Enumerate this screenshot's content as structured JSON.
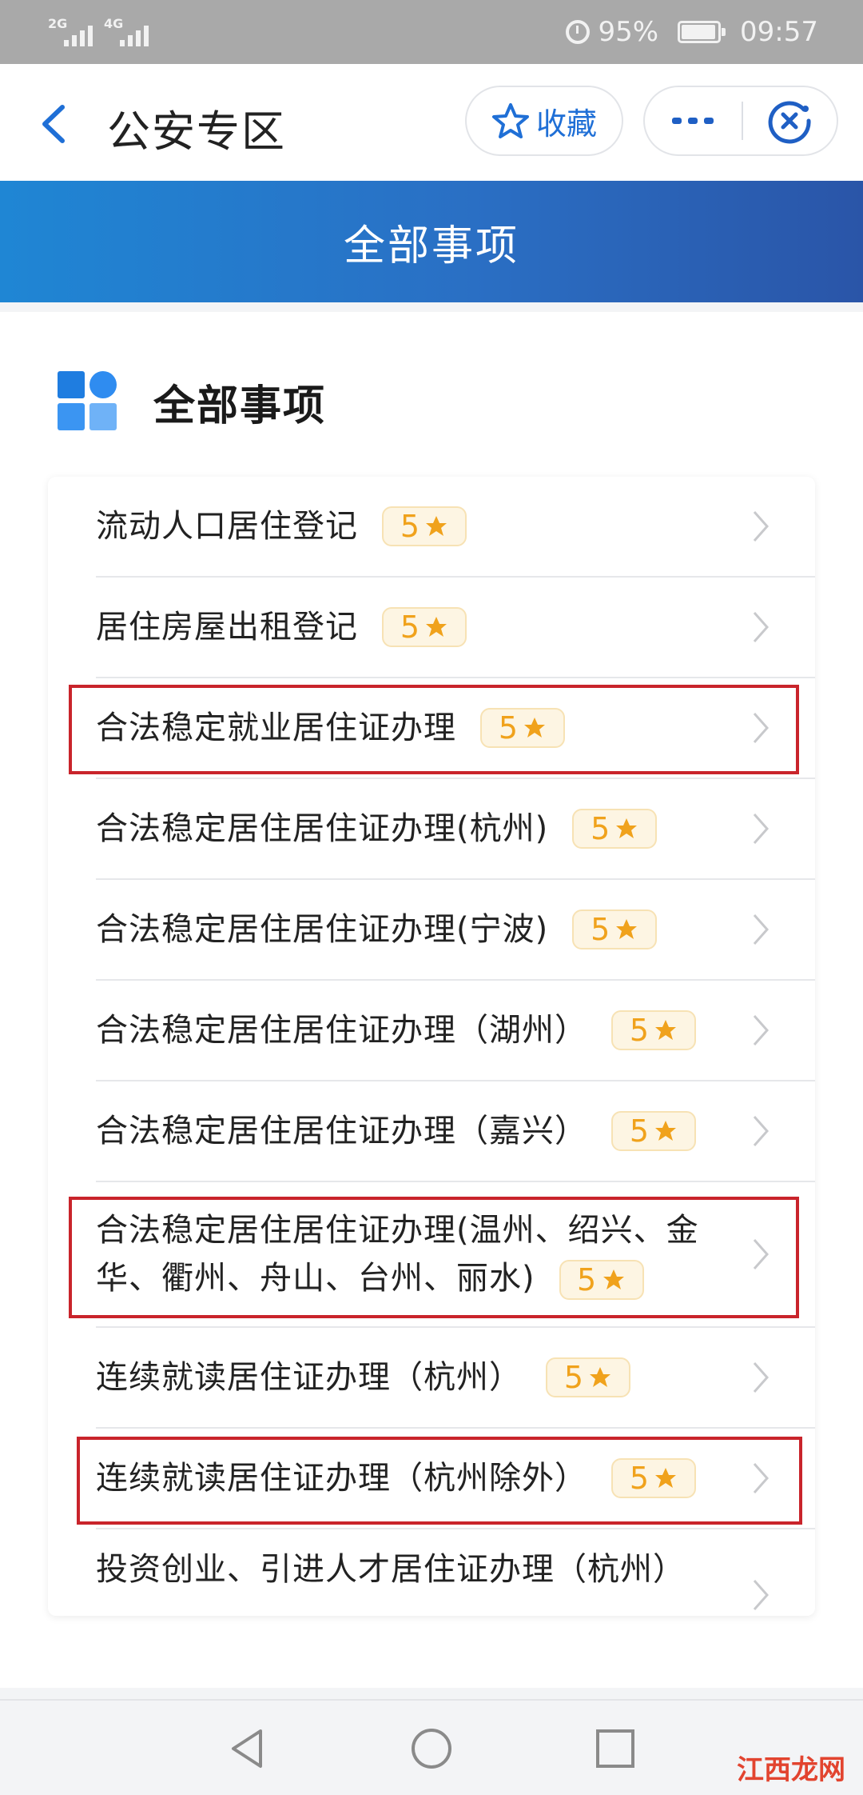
{
  "status_bar": {
    "network1": "2G",
    "network2": "4G",
    "battery": "95%",
    "time": "09:57"
  },
  "nav": {
    "title": "公安专区",
    "favorite_label": "收藏"
  },
  "banner": {
    "title": "全部事项"
  },
  "section": {
    "title": "全部事项"
  },
  "items": [
    {
      "label": "流动人口居住登记",
      "rating": "5"
    },
    {
      "label": "居住房屋出租登记",
      "rating": "5"
    },
    {
      "label": "合法稳定就业居住证办理",
      "rating": "5"
    },
    {
      "label": "合法稳定居住居住证办理(杭州)",
      "rating": "5"
    },
    {
      "label": "合法稳定居住居住证办理(宁波)",
      "rating": "5"
    },
    {
      "label": "合法稳定居住居住证办理（湖州）",
      "rating": "5"
    },
    {
      "label": "合法稳定居住居住证办理（嘉兴）",
      "rating": "5"
    },
    {
      "label": "合法稳定居住居住证办理(温州、绍兴、金华、衢州、舟山、台州、丽水)",
      "rating": "5"
    },
    {
      "label": "连续就读居住证办理（杭州）",
      "rating": "5"
    },
    {
      "label": "连续就读居住证办理（杭州除外）",
      "rating": "5"
    },
    {
      "label": "投资创业、引进人才居住证办理（杭州）",
      "rating": ""
    }
  ],
  "watermark": "江西龙网",
  "colors": {
    "accent": "#1f6fd6",
    "banner_start": "#1f86d4",
    "banner_end": "#2a55a8",
    "rating_text": "#f0a21c",
    "highlight": "#c9242b"
  }
}
